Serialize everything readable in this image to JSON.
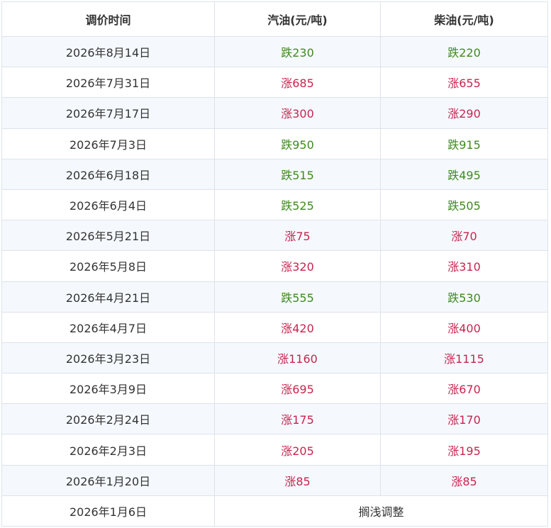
{
  "table": {
    "headers": [
      "调价时间",
      "汽油(元/吨)",
      "柴油(元/吨)"
    ],
    "rows": [
      {
        "date": "2026年8月14日",
        "gasoline": "跌230",
        "diesel": "跌220",
        "direction": "down"
      },
      {
        "date": "2026年7月31日",
        "gasoline": "涨685",
        "diesel": "涨655",
        "direction": "up"
      },
      {
        "date": "2026年7月17日",
        "gasoline": "涨300",
        "diesel": "涨290",
        "direction": "up"
      },
      {
        "date": "2026年7月3日",
        "gasoline": "跌950",
        "diesel": "跌915",
        "direction": "down"
      },
      {
        "date": "2026年6月18日",
        "gasoline": "跌515",
        "diesel": "跌495",
        "direction": "down"
      },
      {
        "date": "2026年6月4日",
        "gasoline": "跌525",
        "diesel": "跌505",
        "direction": "down"
      },
      {
        "date": "2026年5月21日",
        "gasoline": "涨75",
        "diesel": "涨70",
        "direction": "up"
      },
      {
        "date": "2026年5月8日",
        "gasoline": "涨320",
        "diesel": "涨310",
        "direction": "up"
      },
      {
        "date": "2026年4月21日",
        "gasoline": "跌555",
        "diesel": "跌530",
        "direction": "down"
      },
      {
        "date": "2026年4月7日",
        "gasoline": "涨420",
        "diesel": "涨400",
        "direction": "up"
      },
      {
        "date": "2026年3月23日",
        "gasoline": "涨1160",
        "diesel": "涨1115",
        "direction": "up"
      },
      {
        "date": "2026年3月9日",
        "gasoline": "涨695",
        "diesel": "涨670",
        "direction": "up"
      },
      {
        "date": "2026年2月24日",
        "gasoline": "涨175",
        "diesel": "涨170",
        "direction": "up"
      },
      {
        "date": "2026年2月3日",
        "gasoline": "涨205",
        "diesel": "涨195",
        "direction": "up"
      },
      {
        "date": "2026年1月20日",
        "gasoline": "涨85",
        "diesel": "涨85",
        "direction": "up"
      }
    ],
    "last_row": {
      "date": "2026年1月6日",
      "note": "搁浅调整"
    }
  },
  "colors": {
    "up": "#c7254e",
    "down": "#3f8a1e",
    "stripe": "#f5f9fe",
    "border": "#dde3ea"
  }
}
